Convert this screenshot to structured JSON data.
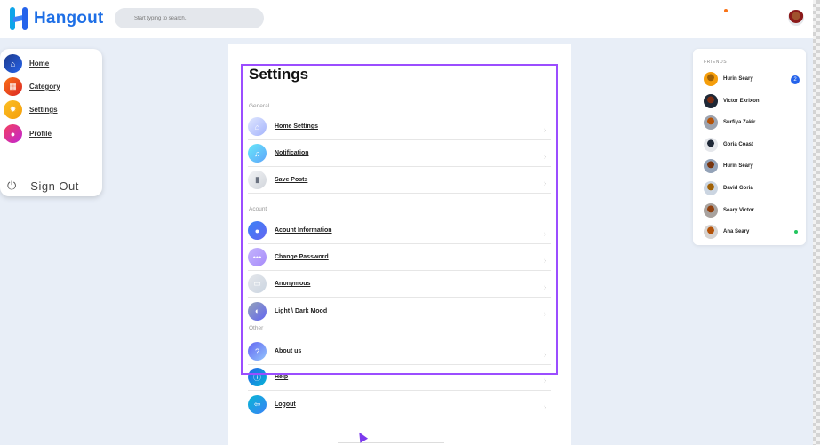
{
  "app": {
    "name": "Hangout"
  },
  "search": {
    "placeholder": "Start typing to search.."
  },
  "colors": {
    "accent": "#1e6fe6",
    "highlight": "#9b4dff",
    "online": "#22c55e"
  },
  "nav": {
    "items": [
      {
        "label": "Home",
        "icon": "home-icon",
        "color": "#1e40af"
      },
      {
        "label": "Category",
        "icon": "grid-icon",
        "color": "#ea580c"
      },
      {
        "label": "Settings",
        "icon": "gear-icon",
        "color": "#f59e0b"
      },
      {
        "label": "Profile",
        "icon": "user-icon",
        "color": "#e11d48"
      }
    ],
    "signout": "Sign Out"
  },
  "settings": {
    "title": "Settings",
    "sections": [
      {
        "label": "General",
        "rows": [
          {
            "label": "Home Settings",
            "icon": "home-icon"
          },
          {
            "label": "Notification",
            "icon": "bell-icon"
          },
          {
            "label": "Save Posts",
            "icon": "bookmark-icon"
          }
        ]
      },
      {
        "label": "Acount",
        "rows": [
          {
            "label": "Acount Information",
            "icon": "user-icon"
          },
          {
            "label": "Change Password",
            "icon": "password-icon"
          },
          {
            "label": "Anonymous",
            "icon": "mask-icon"
          },
          {
            "label": "Light \\ Dark Mood",
            "icon": "moon-icon"
          }
        ]
      },
      {
        "label": "Other",
        "rows": [
          {
            "label": "About us",
            "icon": "question-icon"
          },
          {
            "label": "Help",
            "icon": "help-icon"
          },
          {
            "label": "Logout",
            "icon": "logout-icon"
          }
        ]
      }
    ]
  },
  "friends": {
    "title": "FRIENDS",
    "list": [
      {
        "name": "Hurin Seary",
        "badge": "2"
      },
      {
        "name": "Victor Exrixon"
      },
      {
        "name": "Surfiya Zakir"
      },
      {
        "name": "Goria Coast"
      },
      {
        "name": "Hurin Seary"
      },
      {
        "name": "David Goria"
      },
      {
        "name": "Seary Victor"
      },
      {
        "name": "Ana Seary",
        "online": true
      }
    ]
  }
}
